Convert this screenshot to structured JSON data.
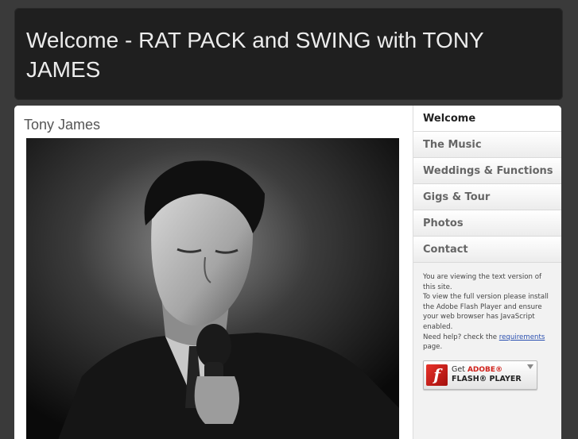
{
  "header": {
    "title": "Welcome - RAT PACK and SWING with TONY JAMES"
  },
  "content": {
    "heading": "Tony James"
  },
  "nav": {
    "items": [
      {
        "label": "Welcome",
        "active": true
      },
      {
        "label": "The Music"
      },
      {
        "label": "Weddings & Functions"
      },
      {
        "label": "Gigs & Tour"
      },
      {
        "label": "Photos"
      },
      {
        "label": "Contact"
      }
    ]
  },
  "notice": {
    "line1": "You are viewing the text version of this site.",
    "line2": "To view the full version please install the Adobe Flash Player and ensure your web browser has JavaScript enabled.",
    "line3_prefix": "Need help? check the ",
    "link": "requirements",
    "line3_suffix": " page."
  },
  "flash_badge": {
    "get": "Get",
    "adobe": "ADOBE®",
    "product": "FLASH® PLAYER"
  },
  "colors": {
    "header_bg": "#1f1f1f",
    "page_bg": "#3a3a3a",
    "flash_red": "#d0211b",
    "link": "#2a4fb0"
  }
}
